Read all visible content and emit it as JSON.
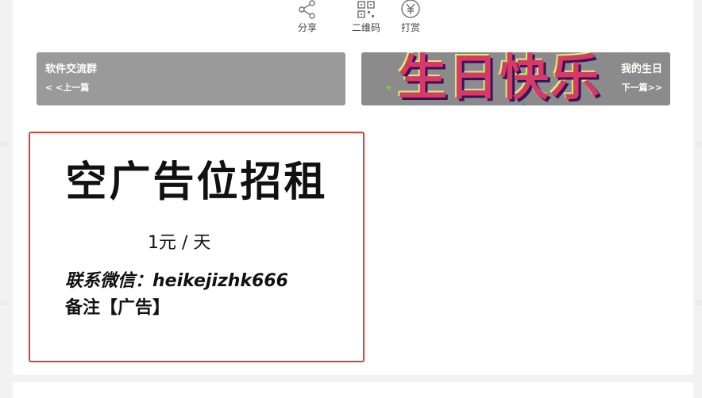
{
  "actions": [
    {
      "label": "分享",
      "icon": "share-icon"
    },
    {
      "label": "二维码",
      "icon": "qrcode-icon"
    },
    {
      "label": "打赏",
      "icon": "yen-icon"
    }
  ],
  "prev_post": {
    "title": "软件交流群",
    "link": "< <上一篇"
  },
  "next_post": {
    "title": "我的生日",
    "link": "下一篇>>",
    "banner_text": "生日快乐"
  },
  "ad": {
    "headline": "空广告位招租",
    "price": "1元 / 天",
    "contact": "联系微信：heikejizhk666",
    "note": "备注【广告】"
  },
  "colors": {
    "ad_border": "#e33a36",
    "banner_pink": "#d63a6c"
  }
}
